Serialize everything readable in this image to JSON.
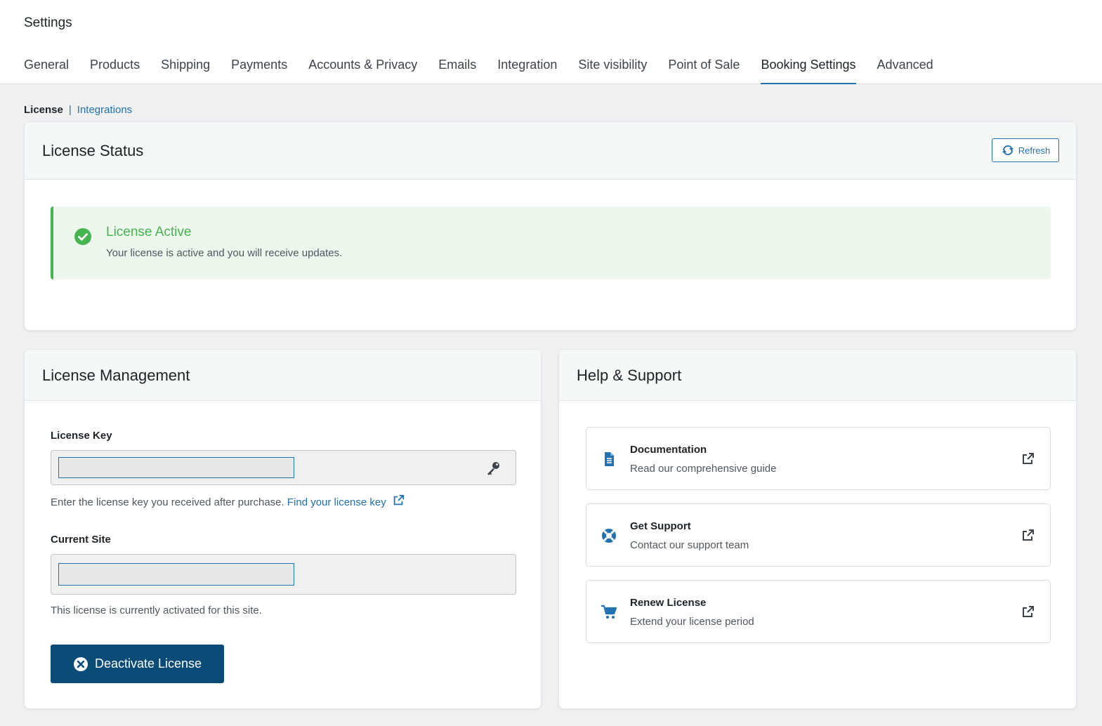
{
  "header": {
    "title": "Settings",
    "tabs": [
      {
        "label": "General"
      },
      {
        "label": "Products"
      },
      {
        "label": "Shipping"
      },
      {
        "label": "Payments"
      },
      {
        "label": "Accounts & Privacy"
      },
      {
        "label": "Emails"
      },
      {
        "label": "Integration"
      },
      {
        "label": "Site visibility"
      },
      {
        "label": "Point of Sale"
      },
      {
        "label": "Booking Settings"
      },
      {
        "label": "Advanced"
      }
    ],
    "active_tab": "Booking Settings"
  },
  "subnav": {
    "current": "License",
    "separator": "|",
    "link": "Integrations"
  },
  "license_status": {
    "title": "License Status",
    "refresh_label": "Refresh",
    "notice_title": "License Active",
    "notice_desc": "Your license is active and you will receive updates.",
    "notice_color": "#46b450"
  },
  "license_management": {
    "title": "License Management",
    "key_label": "License Key",
    "key_help": "Enter the license key you received after purchase.",
    "key_help_link": "Find your license key",
    "site_label": "Current Site",
    "site_help": "This license is currently activated for this site.",
    "deactivate_label": "Deactivate License",
    "button_color": "#0a4b78"
  },
  "help_support": {
    "title": "Help & Support",
    "items": [
      {
        "title": "Documentation",
        "desc": "Read our comprehensive guide",
        "icon": "document-icon"
      },
      {
        "title": "Get Support",
        "desc": "Contact our support team",
        "icon": "lifebuoy-icon"
      },
      {
        "title": "Renew License",
        "desc": "Extend your license period",
        "icon": "cart-icon"
      }
    ]
  },
  "accent_color": "#2271b1"
}
